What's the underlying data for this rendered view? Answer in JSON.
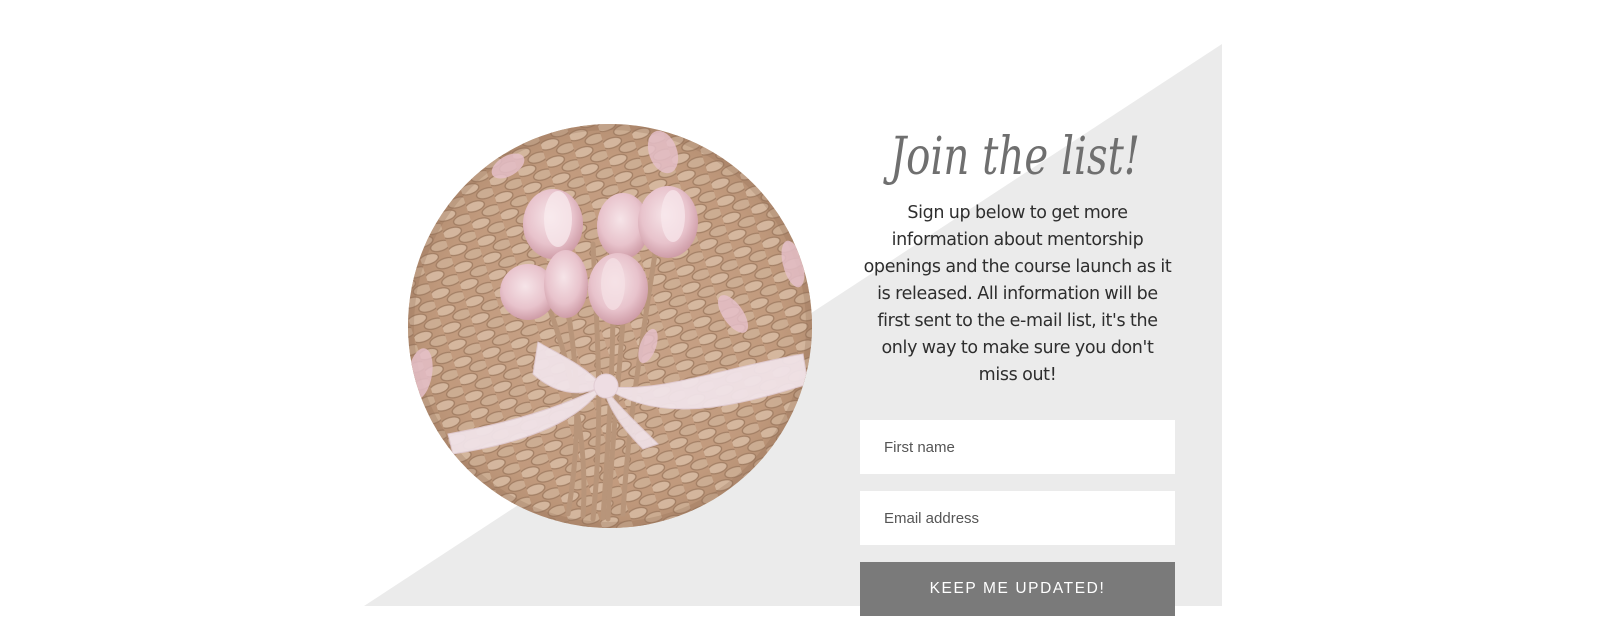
{
  "colors": {
    "page_background": "#ffffff",
    "panel_background": "#ebebeb",
    "heading": "#6f6f6f",
    "body_text": "#2e2e2e",
    "button_background": "#7a7a7a",
    "button_text": "#ffffff",
    "input_background": "#ffffff"
  },
  "photo": {
    "subject": "pink tulip bouquet tied with silk ribbon on woven seagrass placemat"
  },
  "signup": {
    "heading": "Join the list!",
    "description": "Sign up below to get more information about mentorship openings and the course launch as it is released. All information will be first sent to the e-mail list, it's the only way to make sure you don't miss out!",
    "first_name_placeholder": "First name",
    "email_placeholder": "Email address",
    "submit_label": "KEEP ME UPDATED!"
  }
}
